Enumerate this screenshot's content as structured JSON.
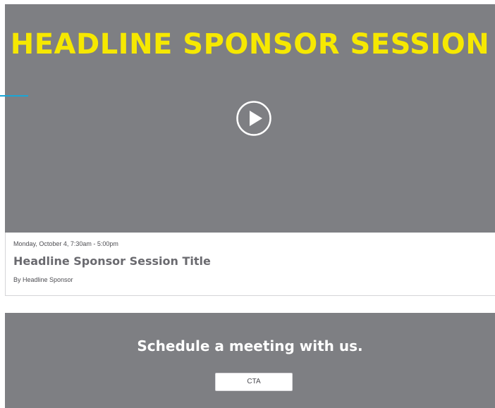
{
  "video": {
    "title": "HEADLINE SPONSOR SESSION",
    "title_color": "#f6e800",
    "background_color": "#7e7f83",
    "play_icon": "play-circle-icon"
  },
  "session": {
    "date": "Monday, October 4, 7:30am - 5:00pm",
    "title": "Headline Sponsor Session Title",
    "sponsor": "By Headline Sponsor"
  },
  "cta": {
    "heading": "Schedule a meeting with us.",
    "button_label": "CTA",
    "background_color": "#7e7f83"
  },
  "accent_color": "#1aa6d6"
}
